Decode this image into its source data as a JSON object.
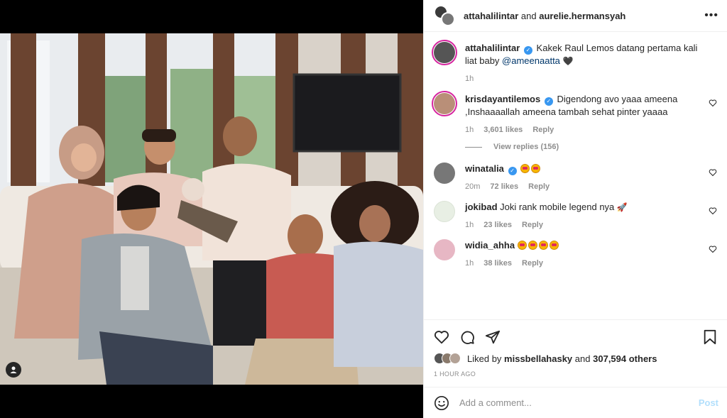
{
  "header": {
    "user1": "attahalilintar",
    "joiner": "and",
    "user2": "aurelie.hermansyah",
    "more_icon": "more-horizontal-icon"
  },
  "caption": {
    "user": "attahalilintar",
    "text": "Kakek Raul Lemos datang pertama kali liat baby",
    "mention": "@ameenaatta",
    "time": "1h"
  },
  "comments": [
    {
      "user": "krisdayantilemos",
      "verified": true,
      "text": "Digendong avo yaaa ameena ,Inshaaaallah ameena tambah sehat pinter yaaaa",
      "time": "1h",
      "likes": "3,601 likes",
      "reply": "Reply",
      "view_replies": "View replies (156)"
    },
    {
      "user": "winatalia",
      "verified": true,
      "emoji_count": 2,
      "time": "20m",
      "likes": "72 likes",
      "reply": "Reply"
    },
    {
      "user": "jokibad",
      "verified": false,
      "text": "Joki rank mobile legend nya",
      "time": "1h",
      "likes": "23 likes",
      "reply": "Reply"
    },
    {
      "user": "widia_ahha",
      "verified": false,
      "emoji_count": 4,
      "time": "1h",
      "likes": "38 likes",
      "reply": "Reply"
    }
  ],
  "actions": {
    "liked_by_prefix": "Liked by",
    "liked_by_user": "missbellahasky",
    "liked_by_and": "and",
    "liked_by_others": "307,594 others",
    "time_ago": "1 HOUR AGO"
  },
  "add_comment": {
    "placeholder": "Add a comment...",
    "post_label": "Post"
  },
  "colors": {
    "link_blue": "#00376b",
    "verified_blue": "#3897f0",
    "muted": "#8e8e8e",
    "post_disabled": "#b2dffc"
  }
}
